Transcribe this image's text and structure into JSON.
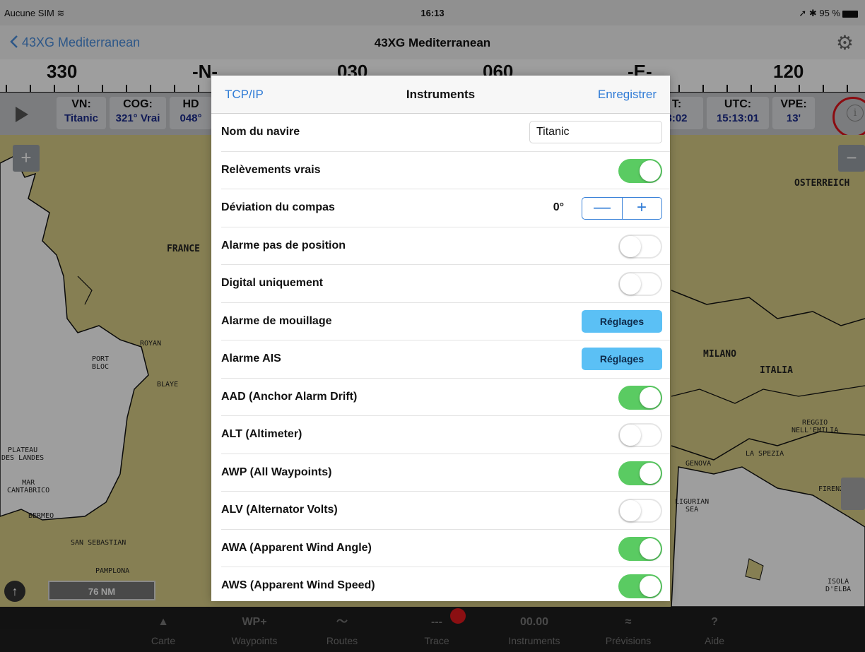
{
  "statusbar": {
    "carrier": "Aucune SIM",
    "wifi": "≋",
    "time": "16:13",
    "battery": "95 %",
    "location_bt": "➚ ✱"
  },
  "navbar": {
    "back_label": "43XG Mediterranean",
    "title": "43XG Mediterranean"
  },
  "compass": [
    "330",
    "-N-",
    "030",
    "060",
    "-E-",
    "120"
  ],
  "instruments": [
    {
      "label": "VN:",
      "value": "Titanic"
    },
    {
      "label": "COG:",
      "value": "321° Vrai"
    },
    {
      "label": "HD",
      "value": "048°"
    },
    {
      "label": "T:",
      "value": "3:02"
    },
    {
      "label": "UTC:",
      "value": "15:13:01"
    },
    {
      "label": "VPE:",
      "value": "13'"
    }
  ],
  "map": {
    "labels": [
      "FRANCE",
      "ROYAN",
      "PORT\nBLOC",
      "BLAYE",
      "PLATEAU\nDES LANDES",
      "MAR\nCANTABRICO",
      "BERMEO",
      "SAN SEBASTIAN",
      "PAMPLONA",
      "OSTERREICH",
      "MILANO",
      "ITALIA",
      "REGGIO\nNELL'EMILIA",
      "LA SPEZIA",
      "GENOVA",
      "FIRENZE",
      "LIGURIAN\nSEA",
      "ISOLA\nD'ELBA"
    ],
    "scale": "76 NM"
  },
  "modal": {
    "left": "TCP/IP",
    "title": "Instruments",
    "right": "Enregistrer",
    "vessel_label": "Nom du navire",
    "vessel_value": "Titanic",
    "rows": [
      {
        "label": "Relèvements vrais",
        "on": true
      },
      {
        "label": "Déviation du compas"
      },
      {
        "label": "Alarme pas de position",
        "on": false
      },
      {
        "label": "Digital uniquement",
        "on": false
      },
      {
        "label": "Alarme de mouillage"
      },
      {
        "label": "Alarme AIS"
      },
      {
        "label": "AAD (Anchor Alarm Drift)",
        "on": true
      },
      {
        "label": "ALT (Altimeter)",
        "on": false
      },
      {
        "label": "AWP (All Waypoints)",
        "on": true
      },
      {
        "label": "ALV (Alternator Volts)",
        "on": false
      },
      {
        "label": "AWA (Apparent Wind Angle)",
        "on": true
      },
      {
        "label": "AWS (Apparent Wind Speed)",
        "on": true
      }
    ],
    "deviation_value": "0°",
    "stepper_minus": "—",
    "stepper_plus": "+",
    "settings_label": "Réglages"
  },
  "tabbar": [
    {
      "icon": "▲",
      "label": "Carte"
    },
    {
      "icon": "WP+",
      "label": "Waypoints"
    },
    {
      "icon": "〜",
      "label": "Routes"
    },
    {
      "icon": "---",
      "label": "Trace"
    },
    {
      "icon": "00.00",
      "label": "Instruments"
    },
    {
      "icon": "≈",
      "label": "Prévisions"
    },
    {
      "icon": "?",
      "label": "Aide"
    }
  ]
}
